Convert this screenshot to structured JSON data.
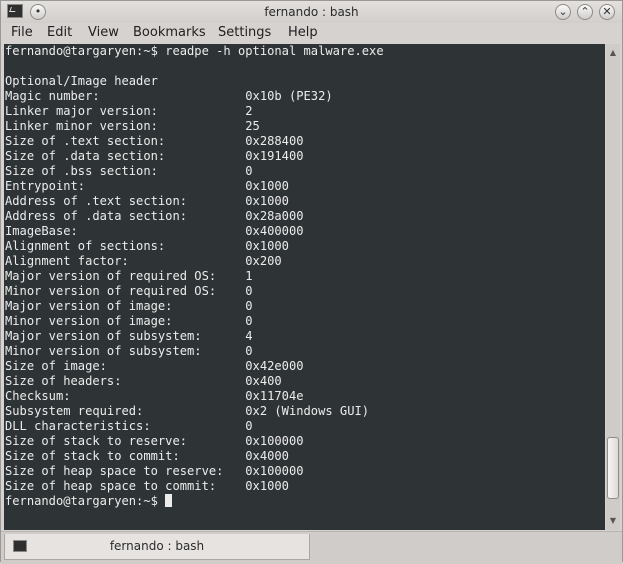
{
  "window": {
    "title": "fernando : bash"
  },
  "menubar": {
    "items": [
      "File",
      "Edit",
      "View",
      "Bookmarks",
      "Settings",
      "Help"
    ]
  },
  "terminal": {
    "prompt": "fernando@targaryen:~$ ",
    "command": "readpe -h optional malware.exe",
    "header": "Optional/Image header",
    "rows": [
      [
        "Magic number:",
        "0x10b (PE32)"
      ],
      [
        "Linker major version:",
        "2"
      ],
      [
        "Linker minor version:",
        "25"
      ],
      [
        "Size of .text section:",
        "0x288400"
      ],
      [
        "Size of .data section:",
        "0x191400"
      ],
      [
        "Size of .bss section:",
        "0"
      ],
      [
        "Entrypoint:",
        "0x1000"
      ],
      [
        "Address of .text section:",
        "0x1000"
      ],
      [
        "Address of .data section:",
        "0x28a000"
      ],
      [
        "ImageBase:",
        "0x400000"
      ],
      [
        "Alignment of sections:",
        "0x1000"
      ],
      [
        "Alignment factor:",
        "0x200"
      ],
      [
        "Major version of required OS:",
        "1"
      ],
      [
        "Minor version of required OS:",
        "0"
      ],
      [
        "Major version of image:",
        "0"
      ],
      [
        "Minor version of image:",
        "0"
      ],
      [
        "Major version of subsystem:",
        "4"
      ],
      [
        "Minor version of subsystem:",
        "0"
      ],
      [
        "Size of image:",
        "0x42e000"
      ],
      [
        "Size of headers:",
        "0x400"
      ],
      [
        "Checksum:",
        "0x11704e"
      ],
      [
        "Subsystem required:",
        "0x2 (Windows GUI)"
      ],
      [
        "DLL characteristics:",
        "0"
      ],
      [
        "Size of stack to reserve:",
        "0x100000"
      ],
      [
        "Size of stack to commit:",
        "0x4000"
      ],
      [
        "Size of heap space to reserve:",
        "0x100000"
      ],
      [
        "Size of heap space to commit:",
        "0x1000"
      ]
    ],
    "final_prompt": "fernando@targaryen:~$ "
  },
  "tabbar": {
    "tabs": [
      {
        "label": "fernando : bash",
        "active": true
      }
    ]
  },
  "icons": {
    "app": "terminal-icon",
    "minimize": "chevron-down-icon",
    "maximize": "chevron-up-icon",
    "close": "close-icon"
  }
}
